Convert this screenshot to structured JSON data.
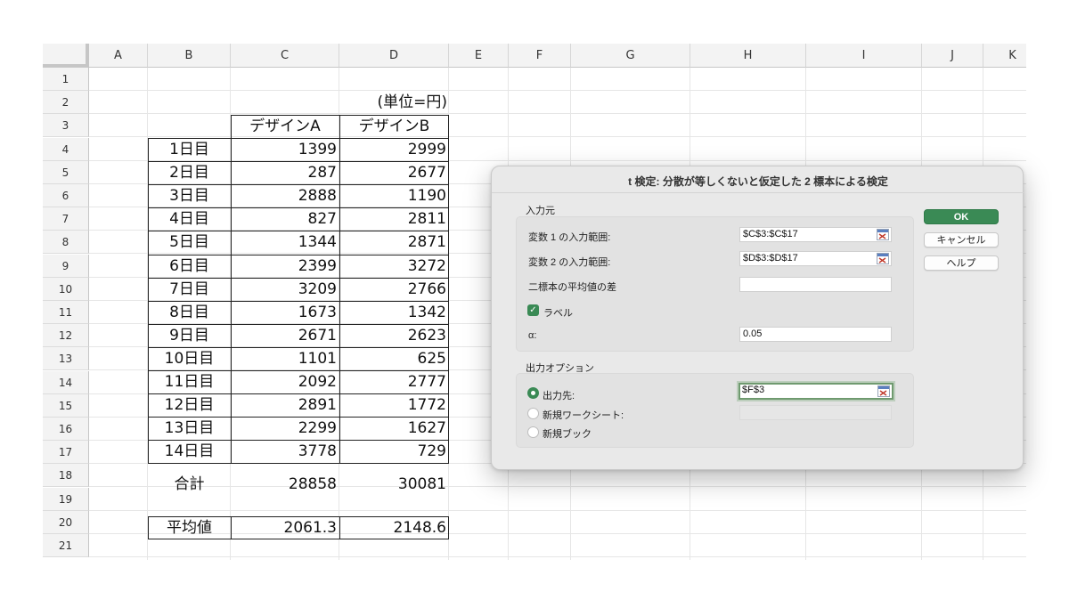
{
  "sheet": {
    "columns": [
      "A",
      "B",
      "C",
      "D",
      "E",
      "F",
      "G",
      "H",
      "I",
      "J",
      "K"
    ],
    "rows": [
      "1",
      "2",
      "3",
      "4",
      "5",
      "6",
      "7",
      "8",
      "9",
      "10",
      "11",
      "12",
      "13",
      "14",
      "15",
      "16",
      "17",
      "18",
      "19",
      "20",
      "21"
    ],
    "unit_label": "(単位=円)",
    "headers": {
      "a": "デザインA",
      "b": "デザインB"
    },
    "data": [
      {
        "day": "1日目",
        "a": "1399",
        "b": "2999"
      },
      {
        "day": "2日目",
        "a": "287",
        "b": "2677"
      },
      {
        "day": "3日目",
        "a": "2888",
        "b": "1190"
      },
      {
        "day": "4日目",
        "a": "827",
        "b": "2811"
      },
      {
        "day": "5日目",
        "a": "1344",
        "b": "2871"
      },
      {
        "day": "6日目",
        "a": "2399",
        "b": "3272"
      },
      {
        "day": "7日目",
        "a": "3209",
        "b": "2766"
      },
      {
        "day": "8日目",
        "a": "1673",
        "b": "1342"
      },
      {
        "day": "9日目",
        "a": "2671",
        "b": "2623"
      },
      {
        "day": "10日目",
        "a": "1101",
        "b": "625"
      },
      {
        "day": "11日目",
        "a": "2092",
        "b": "2777"
      },
      {
        "day": "12日目",
        "a": "2891",
        "b": "1772"
      },
      {
        "day": "13日目",
        "a": "2299",
        "b": "1627"
      },
      {
        "day": "14日目",
        "a": "3778",
        "b": "729"
      }
    ],
    "total": {
      "label": "合計",
      "a": "28858",
      "b": "30081"
    },
    "average": {
      "label": "平均値",
      "a": "2061.3",
      "b": "2148.6"
    }
  },
  "dialog": {
    "title": "t 検定: 分散が等しくないと仮定した 2 標本による検定",
    "input_group": "入力元",
    "var1_label": "変数 1 の入力範囲:",
    "var1_value": "$C$3:$C$17",
    "var2_label": "変数 2 の入力範囲:",
    "var2_value": "$D$3:$D$17",
    "mean_diff_label": "二標本の平均値の差",
    "mean_diff_value": "",
    "labels_checkbox": "ラベル",
    "labels_checked": true,
    "alpha_label": "α:",
    "alpha_value": "0.05",
    "output_group": "出力オプション",
    "output_range_label": "出力先:",
    "output_range_value": "$F$3",
    "new_sheet_label": "新規ワークシート:",
    "new_book_label": "新規ブック",
    "selected_output": "output_range",
    "ok_label": "OK",
    "cancel_label": "キャンセル",
    "help_label": "ヘルプ",
    "ref_icon": "range-select-icon"
  },
  "colors": {
    "accent": "#3a8a55",
    "header_bg": "#f3f3f3",
    "dialog_bg": "#e9e9e9"
  }
}
